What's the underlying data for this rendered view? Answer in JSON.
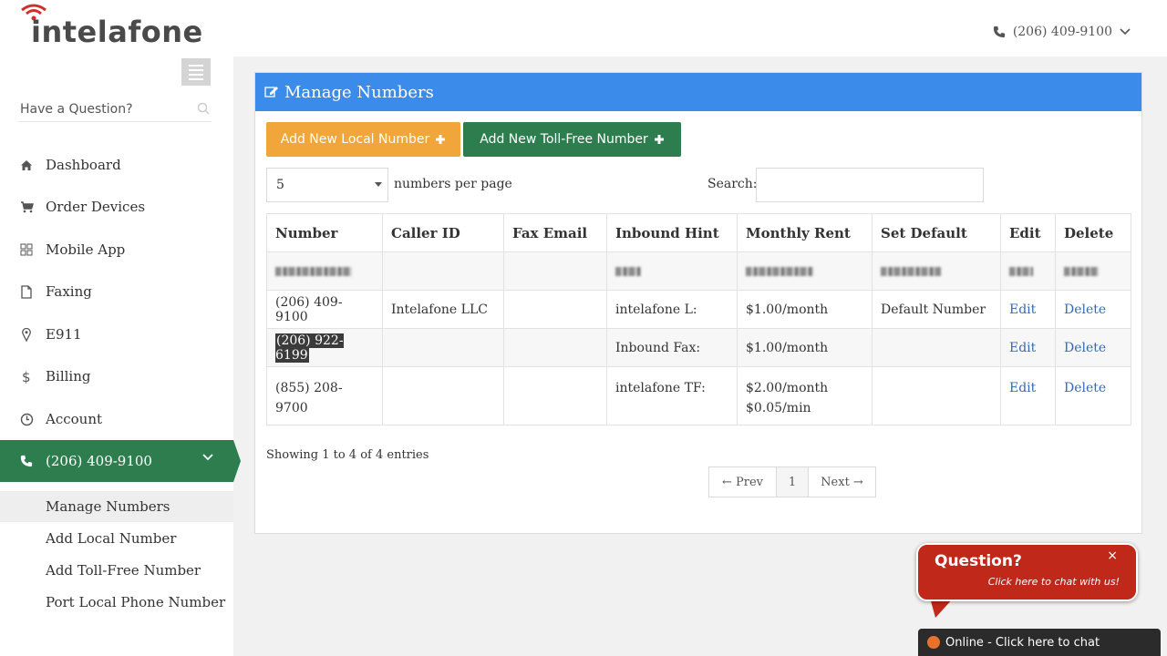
{
  "brand": {
    "name": "intelafone"
  },
  "header": {
    "phone": "(206) 409-9100"
  },
  "sidebar": {
    "question_placeholder": "Have a Question?",
    "items": [
      {
        "label": "Dashboard",
        "icon": "home-icon"
      },
      {
        "label": "Order Devices",
        "icon": "cart-icon"
      },
      {
        "label": "Mobile App",
        "icon": "grid-icon"
      },
      {
        "label": "Faxing",
        "icon": "file-icon"
      },
      {
        "label": "E911",
        "icon": "map-pin-icon"
      },
      {
        "label": "Billing",
        "icon": "dollar-icon"
      },
      {
        "label": "Account",
        "icon": "clock-icon"
      }
    ],
    "active": {
      "label": "(206) 409-9100",
      "icon": "phone-icon"
    },
    "subitems": [
      {
        "label": "Manage Numbers"
      },
      {
        "label": "Add Local Number"
      },
      {
        "label": "Add Toll-Free Number"
      },
      {
        "label": "Port Local Phone Number"
      }
    ]
  },
  "panel": {
    "title": "Manage Numbers",
    "add_local_label": "Add New Local Number",
    "add_tollfree_label": "Add New Toll-Free Number",
    "per_page_value": "5",
    "per_page_label": "numbers per page",
    "search_label": "Search:",
    "search_value": ""
  },
  "table": {
    "headers": [
      "Number",
      "Caller ID",
      "Fax Email",
      "Inbound Hint",
      "Monthly Rent",
      "Set Default",
      "Edit",
      "Delete"
    ],
    "rows": [
      {
        "number": "(206) 409-9100",
        "caller_id": "Intelafone LLC",
        "fax_email": "",
        "inbound_hint": "intelafone L:",
        "rent": "$1.00/month",
        "rent2": "",
        "set_default": "Default Number",
        "edit": "Edit",
        "delete": "Delete"
      },
      {
        "number": "(206) 922-6199",
        "caller_id": "",
        "fax_email": "",
        "inbound_hint": "Inbound Fax:",
        "rent": "$1.00/month",
        "rent2": "",
        "set_default": "",
        "edit": "Edit",
        "delete": "Delete"
      },
      {
        "number": "(855) 208-9700",
        "caller_id": "",
        "fax_email": "",
        "inbound_hint": "intelafone TF:",
        "rent": "$2.00/month",
        "rent2": "$0.05/min",
        "set_default": "",
        "edit": "Edit",
        "delete": "Delete"
      }
    ]
  },
  "footer": {
    "showing": "Showing 1 to 4 of 4 entries",
    "prev": "← Prev",
    "page": "1",
    "next": "Next →"
  },
  "chat": {
    "title": "Question?",
    "subtitle": "Click here to chat with us!",
    "close": "×",
    "status": "Online - Click here to chat"
  }
}
